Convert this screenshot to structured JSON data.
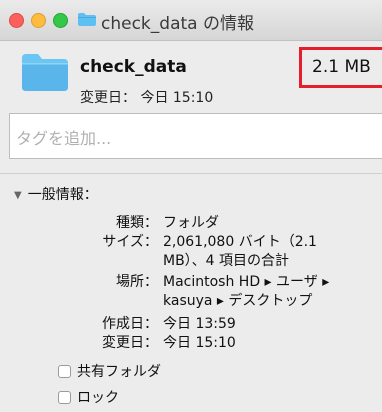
{
  "window": {
    "title": "check_data の情報"
  },
  "header": {
    "name": "check_data",
    "modified_label": "変更日：",
    "modified_value": "今日 15:10",
    "size": "2.1 MB"
  },
  "tags": {
    "placeholder": "タグを追加..."
  },
  "general": {
    "heading": "一般情報：",
    "kind_label": "種類：",
    "kind_value": "フォルダ",
    "size_label": "サイズ：",
    "size_line1": "2,061,080 バイト（2.1",
    "size_line2": "MB）、4 項目の合計",
    "where_label": "場所：",
    "where_line1": "Macintosh HD ▸ ユーザ ▸",
    "where_line2": "kasuya ▸ デスクトップ",
    "created_label": "作成日：",
    "created_value": "今日 13:59",
    "modified_label": "変更日：",
    "modified_value": "今日 15:10",
    "shared_folder": "共有フォルダ",
    "locked": "ロック"
  },
  "colors": {
    "highlight_box": "#e41f2b",
    "folder_blue": "#5ec0f2"
  },
  "icons": {
    "title_folder": "folder-icon",
    "big_folder": "folder-icon",
    "disclosure": "disclosure-triangle-icon"
  }
}
